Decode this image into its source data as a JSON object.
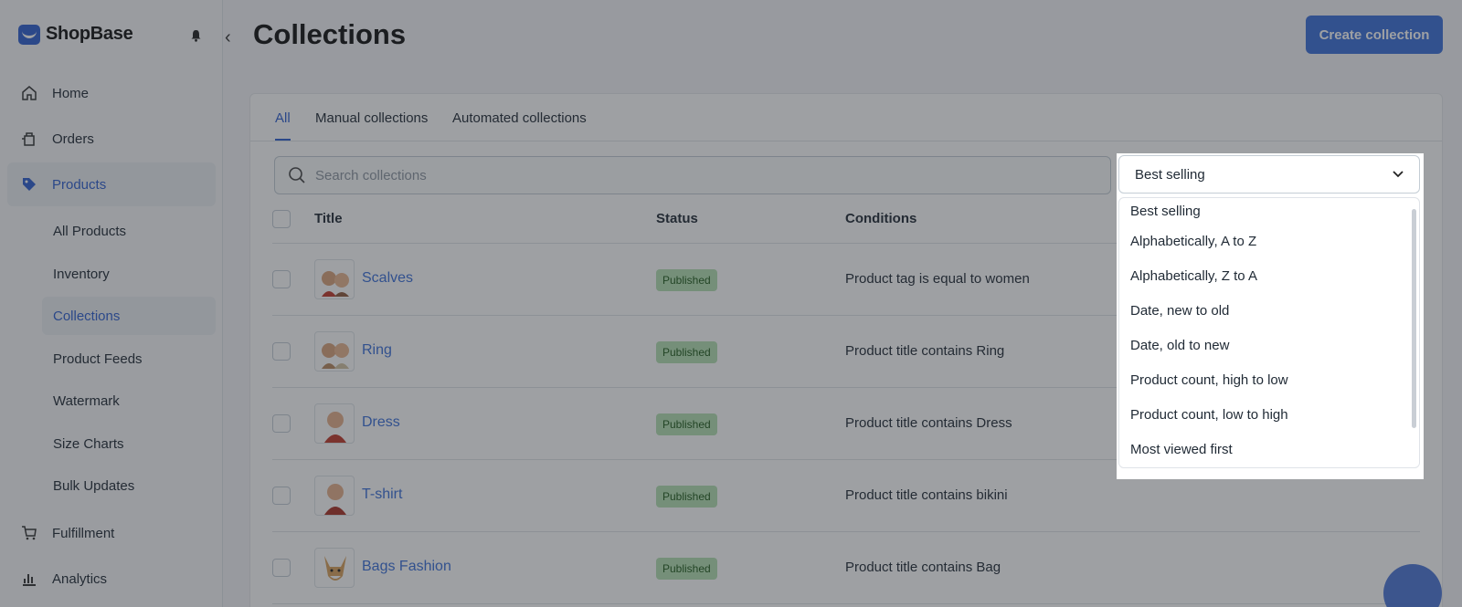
{
  "app": {
    "name": "ShopBase"
  },
  "sidebar": {
    "items": [
      {
        "label": "Home",
        "icon": "home-icon"
      },
      {
        "label": "Orders",
        "icon": "orders-icon"
      },
      {
        "label": "Products",
        "icon": "tag-icon",
        "active": true
      },
      {
        "label": "Fulfillment",
        "icon": "cart-icon"
      },
      {
        "label": "Analytics",
        "icon": "chart-icon"
      }
    ],
    "sub_items": [
      {
        "label": "All Products"
      },
      {
        "label": "Inventory"
      },
      {
        "label": "Collections",
        "active": true
      },
      {
        "label": "Product Feeds"
      },
      {
        "label": "Watermark"
      },
      {
        "label": "Size Charts"
      },
      {
        "label": "Bulk Updates"
      }
    ]
  },
  "header": {
    "title": "Collections",
    "create_label": "Create collection"
  },
  "tabs": [
    {
      "label": "All",
      "active": true
    },
    {
      "label": "Manual collections"
    },
    {
      "label": "Automated collections"
    }
  ],
  "search": {
    "placeholder": "Search collections",
    "value": ""
  },
  "sort": {
    "selected": "Best selling",
    "options": [
      "Best selling",
      "Alphabetically, A to Z",
      "Alphabetically, Z to A",
      "Date, new to old",
      "Date, old to new",
      "Product count, high to low",
      "Product count, low to high",
      "Most viewed first"
    ]
  },
  "table": {
    "headers": {
      "title": "Title",
      "status": "Status",
      "conditions": "Conditions"
    },
    "rows": [
      {
        "title": "Scalves",
        "status": "Published",
        "condition": "Product tag is equal to women"
      },
      {
        "title": "Ring",
        "status": "Published",
        "condition": "Product title contains Ring"
      },
      {
        "title": "Dress",
        "status": "Published",
        "condition": "Product title contains Dress"
      },
      {
        "title": "T-shirt",
        "status": "Published",
        "condition": "Product title contains bikini"
      },
      {
        "title": "Bags Fashion",
        "status": "Published",
        "condition": "Product title contains Bag"
      }
    ]
  },
  "colors": {
    "accent": "#2f5fd0",
    "badge": "#b5e0b2",
    "overlay": "rgba(40,45,52,0.45)"
  }
}
